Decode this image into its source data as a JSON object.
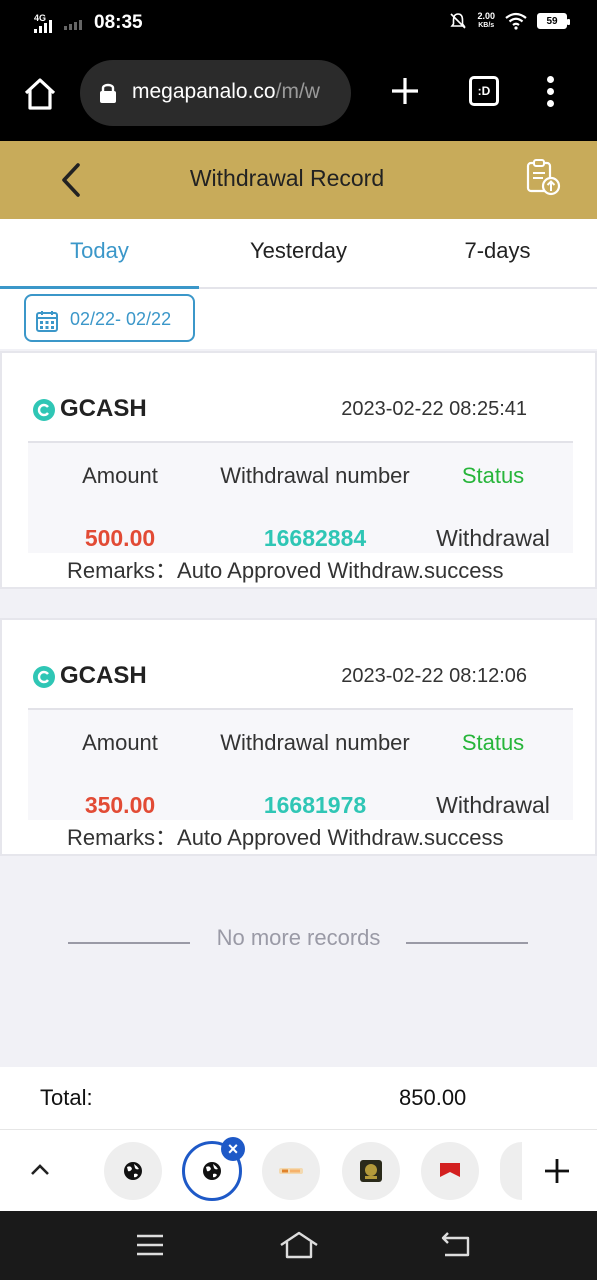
{
  "statusbar": {
    "network": "4G",
    "time": "08:35",
    "speed_value": "2.00",
    "speed_unit": "KB/s",
    "battery": "59"
  },
  "browser": {
    "url_host": "megapanalo.co",
    "url_path": "/m/w",
    "tabs_label": ":D"
  },
  "header": {
    "title": "Withdrawal Record"
  },
  "tabs": [
    {
      "label": "Today",
      "active": true
    },
    {
      "label": "Yesterday",
      "active": false
    },
    {
      "label": "7-days",
      "active": false
    }
  ],
  "date_range": "02/22- 02/22",
  "column_labels": {
    "amount": "Amount",
    "number": "Withdrawal number",
    "status": "Status",
    "remarks_label": "Remarks："
  },
  "records": [
    {
      "method": "GCASH",
      "datetime": "2023-02-22 08:25:41",
      "amount": "500.00",
      "number": "16682884",
      "status": "Withdrawal",
      "remarks": "Auto Approved Withdraw.success"
    },
    {
      "method": "GCASH",
      "datetime": "2023-02-22 08:12:06",
      "amount": "350.00",
      "number": "16681978",
      "status": "Withdrawal",
      "remarks": "Auto Approved Withdraw.success"
    }
  ],
  "no_more": "No more records",
  "total": {
    "label": "Total:",
    "value": "850.00"
  },
  "colors": {
    "header_gold": "#c8ab5a",
    "accent_blue": "#3b97c9",
    "amount_red": "#e24b35",
    "number_teal": "#2fc6b5",
    "status_green": "#27b53a"
  }
}
